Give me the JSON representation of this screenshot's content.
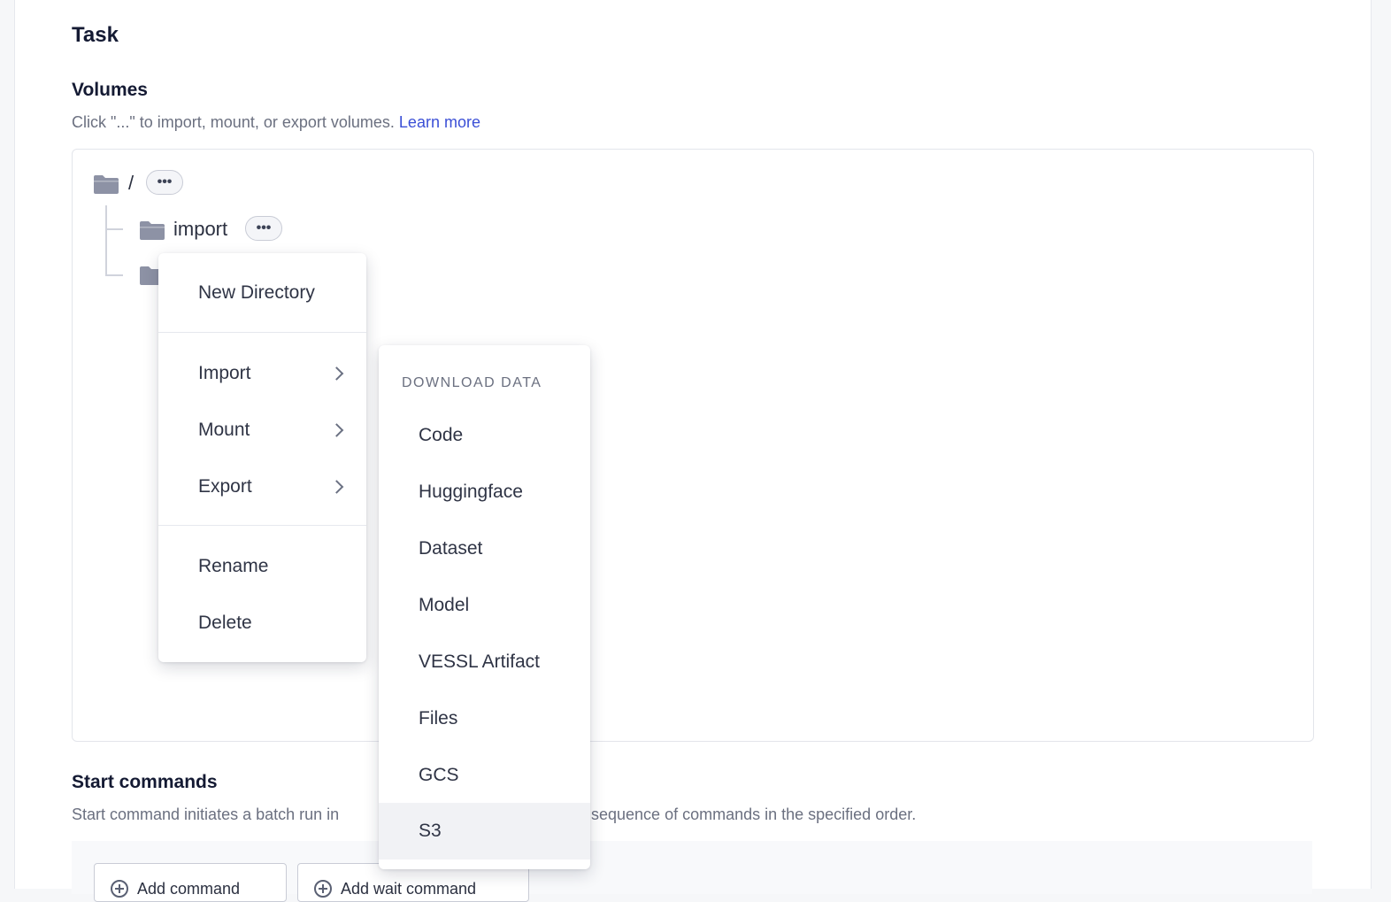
{
  "section": {
    "title": "Task"
  },
  "volumes": {
    "heading": "Volumes",
    "description": "Click \"...\" to import, mount, or export volumes.",
    "learn_more": "Learn more",
    "tree": {
      "root": {
        "label": "/",
        "menu_dots": "•••"
      },
      "child": {
        "label": "import",
        "menu_dots": "•••"
      }
    }
  },
  "context_menu": {
    "items": [
      {
        "label": "New Directory"
      },
      {
        "label": "Import",
        "submenu": true
      },
      {
        "label": "Mount",
        "submenu": true
      },
      {
        "label": "Export",
        "submenu": true
      },
      {
        "label": "Rename"
      },
      {
        "label": "Delete"
      }
    ]
  },
  "submenu": {
    "header": "DOWNLOAD DATA",
    "items": [
      "Code",
      "Huggingface",
      "Dataset",
      "Model",
      "VESSL Artifact",
      "Files",
      "GCS",
      "S3"
    ],
    "hovered": "S3"
  },
  "start_commands": {
    "heading": "Start commands",
    "description_left": "Start command initiates a batch run in",
    "description_right": "sequence of commands in the specified order.",
    "buttons": {
      "add_command": "Add command",
      "add_wait_command": "Add wait command"
    }
  }
}
